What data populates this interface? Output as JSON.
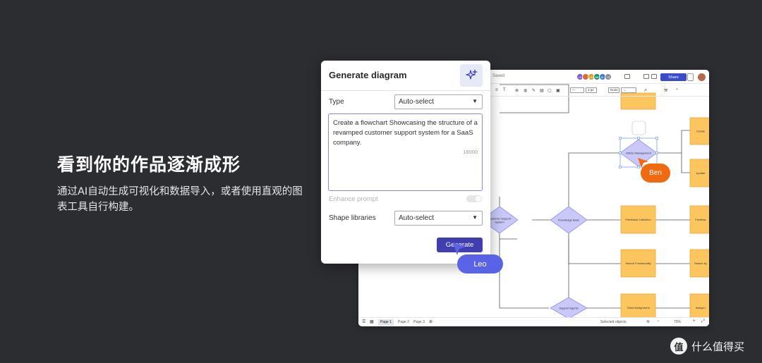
{
  "headline": "看到你的作品逐渐成形",
  "subcopy": "通过AI自动生成可视化和数据导入，或者使用直观的图表工具自行构建。",
  "editor": {
    "saved_label": "Saved",
    "avatars": [
      {
        "initials": "LS",
        "color": "#7b5bd6"
      },
      {
        "initials": "",
        "color": "#e0683b"
      },
      {
        "initials": "KH",
        "color": "#d4a21d"
      },
      {
        "initials": "BB",
        "color": "#1e8f6c"
      },
      {
        "initials": "AL",
        "color": "#3b7bd6"
      },
      {
        "initials": "+3",
        "color": "#8a8f9a"
      }
    ],
    "share_label": "Share",
    "toolbar": {
      "text_tool": "T",
      "line_width": "2 px",
      "arrow_start": "None"
    },
    "pages": [
      "Page 1",
      "Page 2",
      "Page 3"
    ],
    "status": {
      "selected_objects": "Selected objects",
      "zoom": "70%"
    }
  },
  "diagram": {
    "nodes": {
      "customer_support_system": "Customer Support System",
      "knowledge_base": "Knowledge Base",
      "support_agents": "Support Agents",
      "article_management": "Article Management",
      "feedback_collection": "Feedback Collection",
      "search_functionality": "Search Functionality",
      "ticket_assignment": "Ticket Assignment",
      "create": "Create",
      "update": "Update",
      "feedback": "Feedbac",
      "search_by": "Search by",
      "assign": "Assign t"
    },
    "colors": {
      "diamond_fill": "#c9c8f9",
      "diamond_stroke": "#9290e8",
      "rect_fill": "#fdc55e",
      "rect_stroke": "#e6a93e",
      "connector": "#555555",
      "selection": "#4a7cf0"
    }
  },
  "dialog": {
    "title": "Generate diagram",
    "type_label": "Type",
    "type_value": "Auto-select",
    "prompt_text": "Create a flowchart Showcasing the structure of a revamped customer support system for a SaaS company.",
    "char_counter": "18000",
    "enhance_label": "Enhance prompt",
    "shape_libraries_label": "Shape libraries",
    "shape_libraries_value": "Auto-select",
    "generate_label": "Generate",
    "icon": "sparkle-icon"
  },
  "cursors": {
    "leo": "Leo",
    "ben": "Ben"
  },
  "watermark": {
    "logo_char": "值",
    "text": "什么值得买"
  }
}
